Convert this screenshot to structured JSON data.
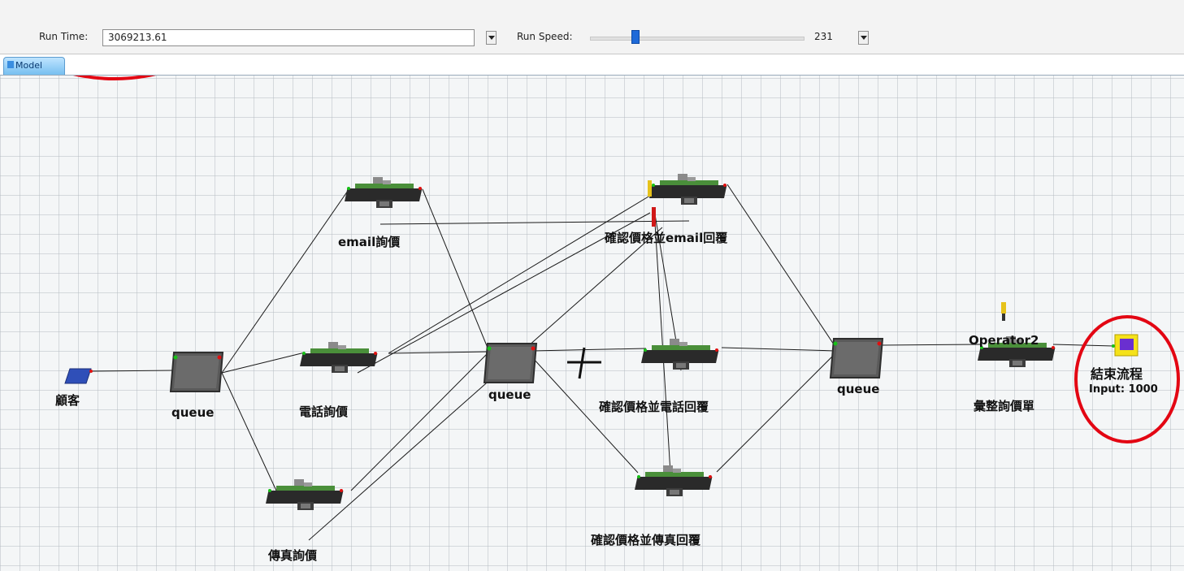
{
  "toolbar": {
    "run_time_label": "Run Time:",
    "run_time_value": "3069213.61",
    "run_speed_label": "Run Speed:",
    "run_speed_value": "231",
    "run_speed_fraction": 0.2
  },
  "tabs": [
    {
      "label": "Model",
      "active": true
    }
  ],
  "model": {
    "objects": {
      "source": "顧客",
      "queue1": "queue",
      "queue2": "queue",
      "queue3": "queue",
      "email_quote": "email詢價",
      "phone_quote": "電話詢價",
      "fax_quote": "傳真詢價",
      "confirm_email": "確認價格並email回覆",
      "confirm_phone": "確認價格並電話回覆",
      "confirm_fax": "確認價格並傳真回覆",
      "operator": "Operator2",
      "compile": "彙整詢價單",
      "sink": "結束流程",
      "sink_input": "Input: 1000"
    }
  },
  "colors": {
    "annotation": "#e30613",
    "processor_body": "#4a8f3a",
    "conveyor": "#2a2a2a",
    "queue_body": "#5a5a5a",
    "source": "#2f4fb8"
  }
}
